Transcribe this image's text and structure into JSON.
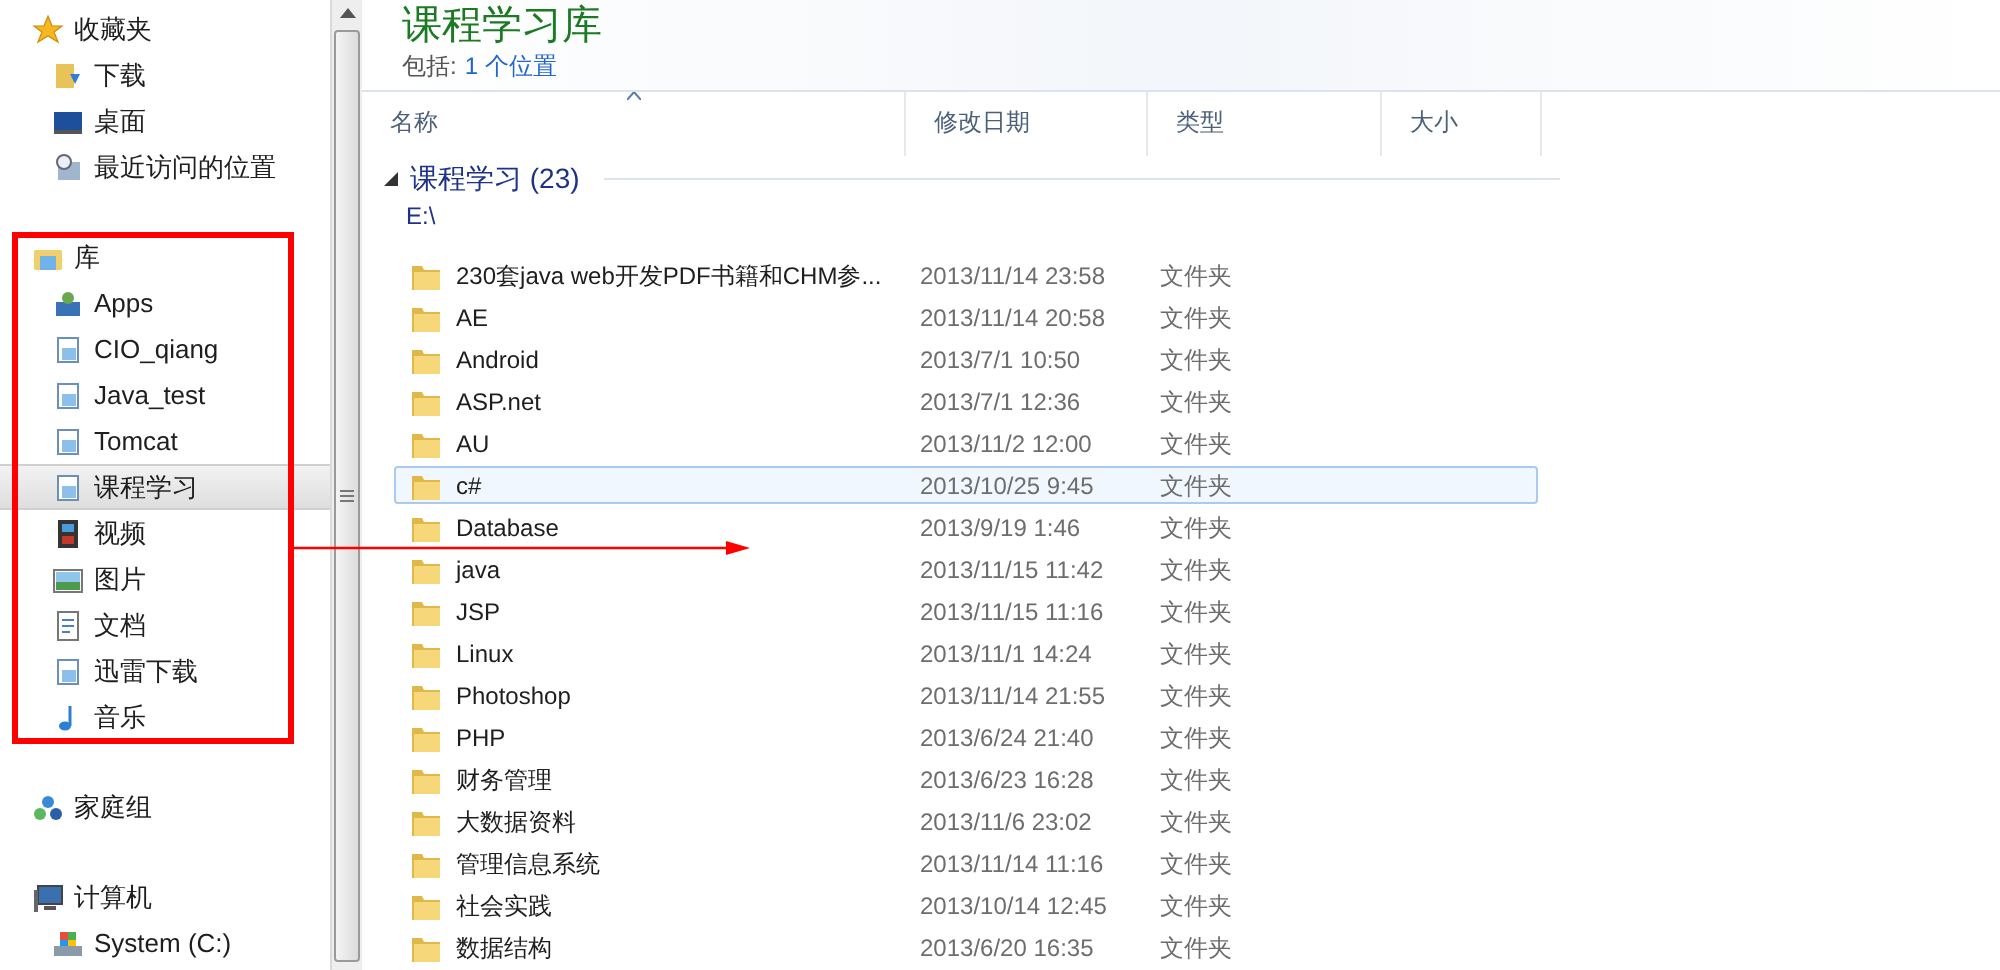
{
  "sidebar": {
    "sections": [
      {
        "label": "收藏夹",
        "kind": "star",
        "children": [
          {
            "label": "下载",
            "kind": "download",
            "selected": false
          },
          {
            "label": "桌面",
            "kind": "desktop",
            "selected": false
          },
          {
            "label": "最近访问的位置",
            "kind": "recent",
            "selected": false
          }
        ]
      },
      {
        "label": "库",
        "kind": "library",
        "children": [
          {
            "label": "Apps",
            "kind": "apps",
            "selected": false
          },
          {
            "label": "CIO_qiang",
            "kind": "doclib",
            "selected": false
          },
          {
            "label": "Java_test",
            "kind": "doclib",
            "selected": false
          },
          {
            "label": "Tomcat",
            "kind": "doclib",
            "selected": false
          },
          {
            "label": "课程学习",
            "kind": "doclib",
            "selected": true
          },
          {
            "label": "视频",
            "kind": "video",
            "selected": false
          },
          {
            "label": "图片",
            "kind": "picture",
            "selected": false
          },
          {
            "label": "文档",
            "kind": "document",
            "selected": false
          },
          {
            "label": "迅雷下载",
            "kind": "doclib",
            "selected": false
          },
          {
            "label": "音乐",
            "kind": "music",
            "selected": false
          }
        ]
      },
      {
        "label": "家庭组",
        "kind": "homegroup"
      },
      {
        "label": "计算机",
        "kind": "computer",
        "children": [
          {
            "label": "System (C:)",
            "kind": "drive",
            "selected": false
          }
        ]
      }
    ]
  },
  "header": {
    "title": "课程学习库",
    "includes_label": "包括:",
    "includes_link": "1 个位置"
  },
  "table": {
    "columns": [
      {
        "label": "名称",
        "sorted": true
      },
      {
        "label": "修改日期",
        "sorted": false
      },
      {
        "label": "类型",
        "sorted": false
      },
      {
        "label": "大小",
        "sorted": false
      }
    ],
    "group": {
      "label": "课程学习 (23)",
      "expanded": true,
      "path": "E:\\"
    },
    "rows": [
      {
        "name": "230套java web开发PDF书籍和CHM参...",
        "modified": "2013/11/14 23:58",
        "type": "文件夹",
        "selected": false
      },
      {
        "name": "AE",
        "modified": "2013/11/14 20:58",
        "type": "文件夹",
        "selected": false
      },
      {
        "name": "Android",
        "modified": "2013/7/1 10:50",
        "type": "文件夹",
        "selected": false
      },
      {
        "name": "ASP.net",
        "modified": "2013/7/1 12:36",
        "type": "文件夹",
        "selected": false
      },
      {
        "name": "AU",
        "modified": "2013/11/2 12:00",
        "type": "文件夹",
        "selected": false
      },
      {
        "name": "c#",
        "modified": "2013/10/25 9:45",
        "type": "文件夹",
        "selected": true
      },
      {
        "name": "Database",
        "modified": "2013/9/19 1:46",
        "type": "文件夹",
        "selected": false
      },
      {
        "name": "java",
        "modified": "2013/11/15 11:42",
        "type": "文件夹",
        "selected": false
      },
      {
        "name": "JSP",
        "modified": "2013/11/15 11:16",
        "type": "文件夹",
        "selected": false
      },
      {
        "name": "Linux",
        "modified": "2013/11/1 14:24",
        "type": "文件夹",
        "selected": false
      },
      {
        "name": "Photoshop",
        "modified": "2013/11/14 21:55",
        "type": "文件夹",
        "selected": false
      },
      {
        "name": "PHP",
        "modified": "2013/6/24 21:40",
        "type": "文件夹",
        "selected": false
      },
      {
        "name": "财务管理",
        "modified": "2013/6/23 16:28",
        "type": "文件夹",
        "selected": false
      },
      {
        "name": "大数据资料",
        "modified": "2013/11/6 23:02",
        "type": "文件夹",
        "selected": false
      },
      {
        "name": "管理信息系统",
        "modified": "2013/11/14 11:16",
        "type": "文件夹",
        "selected": false
      },
      {
        "name": "社会实践",
        "modified": "2013/10/14 12:45",
        "type": "文件夹",
        "selected": false
      },
      {
        "name": "数据结构",
        "modified": "2013/6/20 16:35",
        "type": "文件夹",
        "selected": false
      }
    ]
  }
}
